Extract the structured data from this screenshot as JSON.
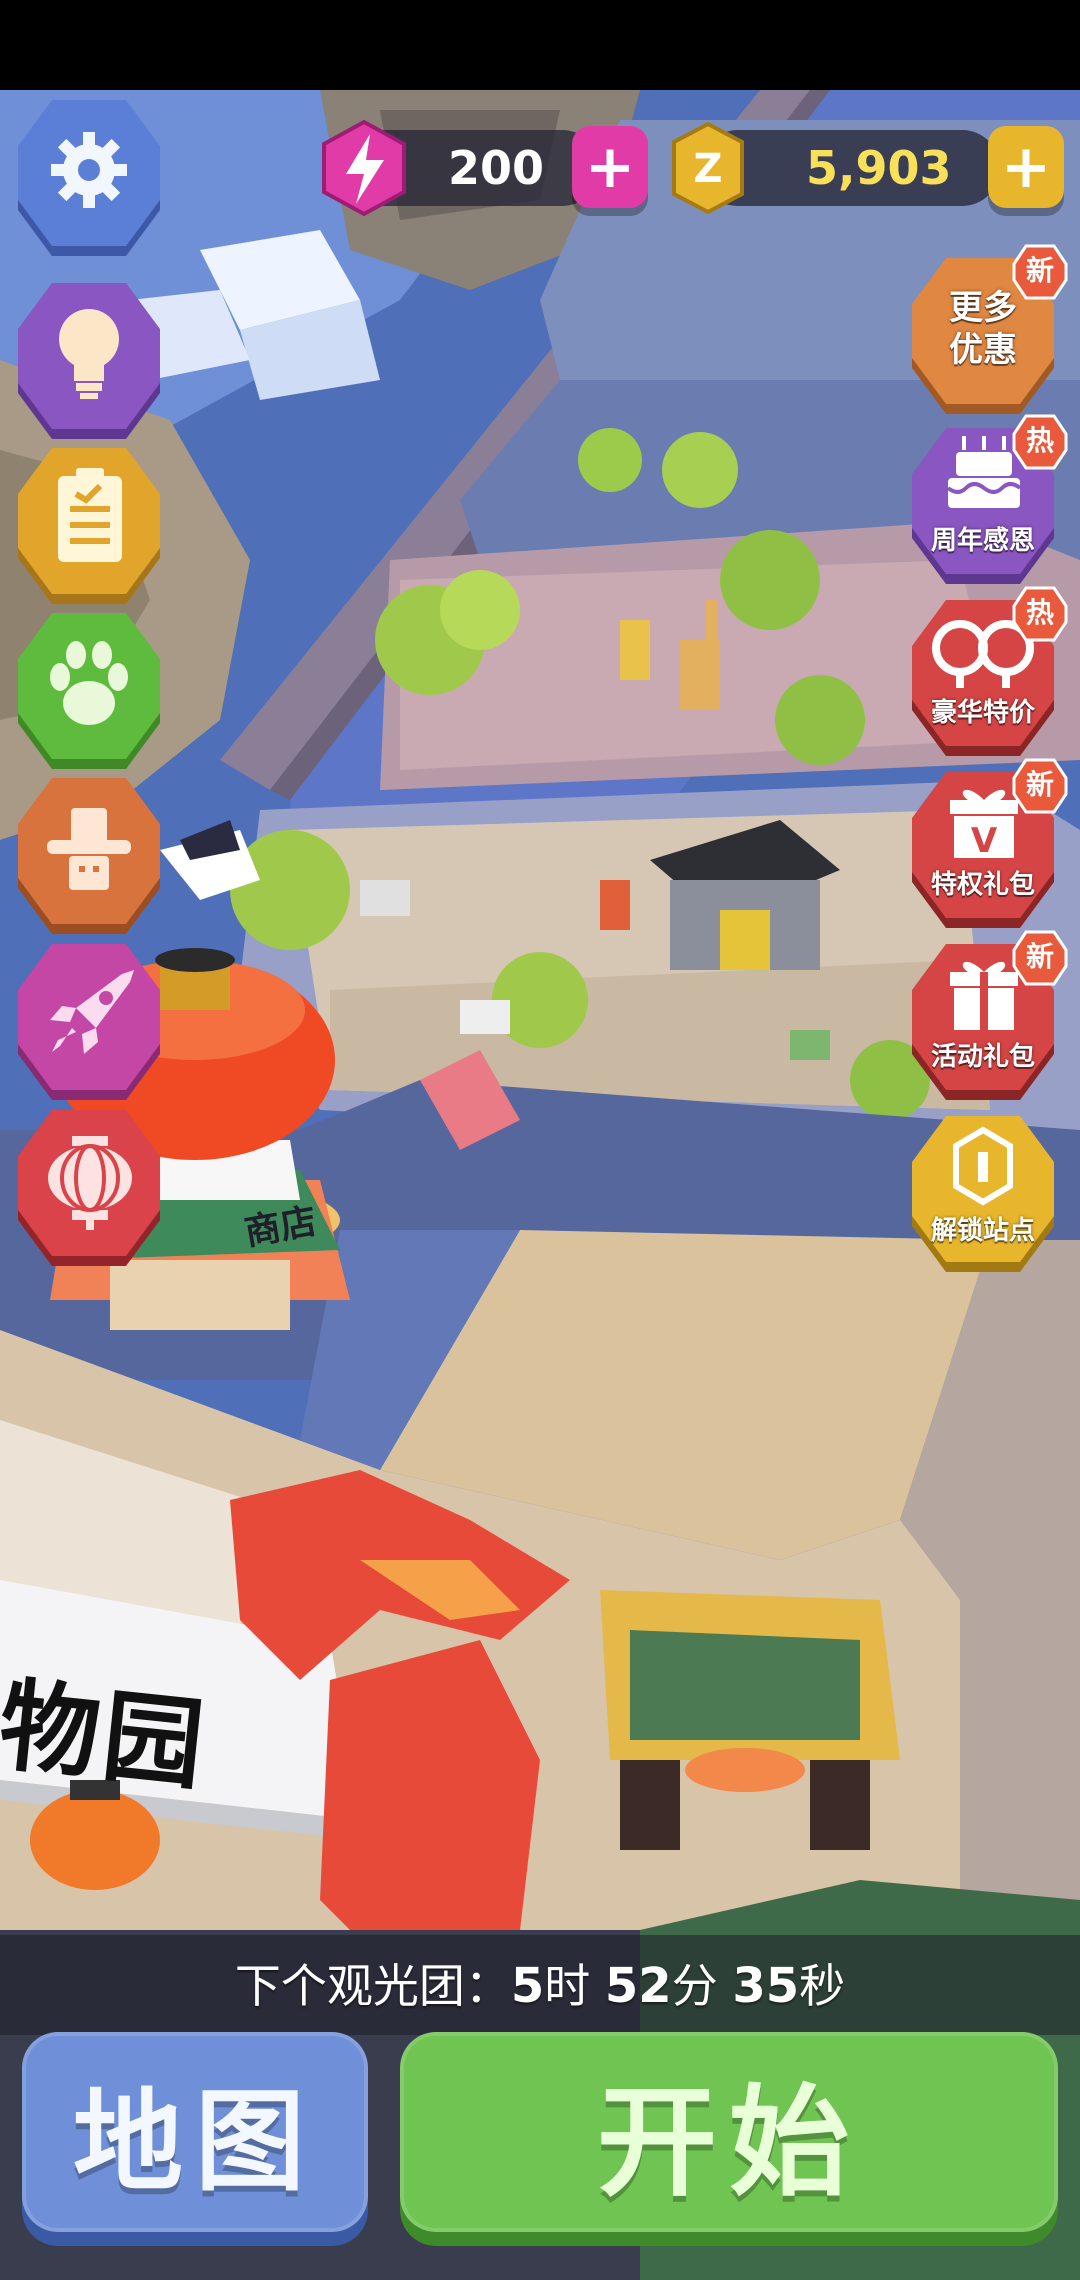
{
  "currency": {
    "energy_value": "200",
    "coins_value": "5,903",
    "energy_plus_label": "+",
    "coins_plus_label": "+",
    "colors": {
      "energy": "#e13ba8",
      "coins": "#e8b62c"
    }
  },
  "left_menu": {
    "items": [
      {
        "name": "settings",
        "icon": "gear-icon",
        "color": "#5b7fd6"
      },
      {
        "name": "tips",
        "icon": "lightbulb-icon",
        "color": "#8a56c2"
      },
      {
        "name": "missions",
        "icon": "clipboard-icon",
        "color": "#e0a52a"
      },
      {
        "name": "animals",
        "icon": "paw-icon",
        "color": "#5fbb3d"
      },
      {
        "name": "zookeeper",
        "icon": "cowboy-hat-icon",
        "color": "#d9733d"
      },
      {
        "name": "rocket",
        "icon": "rocket-icon",
        "color": "#c447a6"
      },
      {
        "name": "lantern-event",
        "icon": "lantern-icon",
        "color": "#d94349"
      }
    ]
  },
  "right_menu": {
    "items": [
      {
        "name": "more-deals",
        "icon": "none",
        "label_line1": "更多",
        "label_line2": "优惠",
        "badge": "新",
        "color": "#e08742"
      },
      {
        "name": "anniversary",
        "icon": "cake-icon",
        "label": "周年感恩",
        "badge": "热",
        "color": "#8a56c2"
      },
      {
        "name": "luxury-deal",
        "icon": "infinity-deal-icon",
        "label": "豪华特价",
        "badge": "热",
        "color": "#d54545"
      },
      {
        "name": "privilege-pack",
        "icon": "gift-vip-icon",
        "label": "特权礼包",
        "badge": "新",
        "color": "#d54545"
      },
      {
        "name": "event-pack",
        "icon": "gift-icon",
        "label": "活动礼包",
        "badge": "新",
        "color": "#d54545"
      },
      {
        "name": "unlock-station",
        "icon": "unlock-station-icon",
        "label": "解锁站点",
        "badge": "",
        "color": "#e8b62c"
      }
    ]
  },
  "scene": {
    "shop_sign": "商店",
    "zoo_sign": "物园"
  },
  "tour": {
    "prefix": "下个观光团：",
    "hours": "5",
    "hours_unit": "时",
    "minutes": "52",
    "minutes_unit": "分",
    "seconds": "35",
    "seconds_unit": "秒"
  },
  "buttons": {
    "map_label": "地图",
    "start_label": "开始"
  }
}
